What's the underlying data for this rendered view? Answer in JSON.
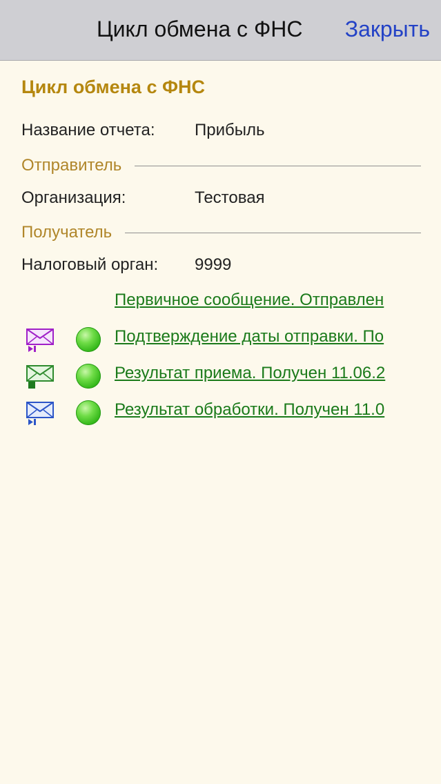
{
  "header": {
    "title": "Цикл обмена с ФНС",
    "close_label": "Закрыть"
  },
  "form": {
    "title": "Цикл обмена с ФНС",
    "report_name_label": "Название отчета:",
    "report_name_value": "Прибыль",
    "sender_group": "Отправитель",
    "organization_label": "Организация:",
    "organization_value": "Тестовая",
    "recipient_group": "Получатель",
    "tax_authority_label": "Налоговый орган:",
    "tax_authority_value": "9999"
  },
  "messages": [
    {
      "icon": "none",
      "status": "none",
      "text": "Первичное сообщение. Отправлен"
    },
    {
      "icon": "envelope-purple-icon",
      "status": "green",
      "text": "Подтверждение даты отправки. По"
    },
    {
      "icon": "envelope-green-icon",
      "status": "green",
      "text": "Результат приема. Получен 11.06.2"
    },
    {
      "icon": "envelope-blue-icon",
      "status": "green",
      "text": "Результат обработки. Получен 11.0"
    }
  ],
  "colors": {
    "header_bg": "#cfcfd3",
    "page_bg": "#fdf9ec",
    "title_gold": "#b5870f",
    "link_green": "#1a7a1a",
    "close_blue": "#2342c6"
  }
}
